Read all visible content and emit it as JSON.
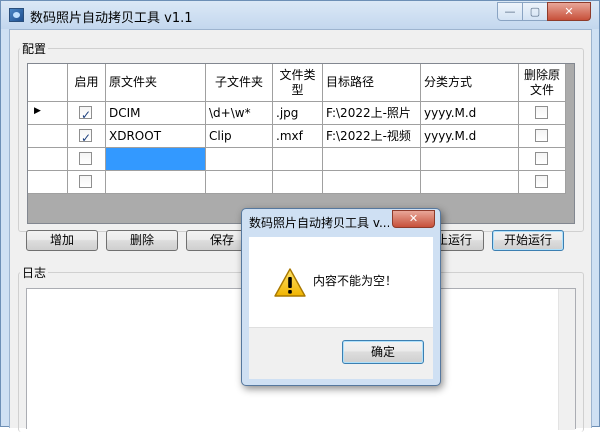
{
  "window": {
    "title": "数码照片自动拷贝工具 v1.1",
    "min_glyph": "—",
    "max_glyph": "▢",
    "close_glyph": "✕"
  },
  "config": {
    "group_label": "配置",
    "columns": [
      "启用",
      "原文件夹",
      "子文件夹",
      "文件类型",
      "目标路径",
      "分类方式",
      "删除原文件"
    ],
    "rows": [
      {
        "enabled": true,
        "source": "DCIM",
        "subfolder": "\\d+\\w*",
        "filetype": ".jpg",
        "target": "F:\\2022上-照片",
        "classify": "yyyy.M.d",
        "delete": false,
        "current": true
      },
      {
        "enabled": true,
        "source": "XDROOT",
        "subfolder": "Clip",
        "filetype": ".mxf",
        "target": "F:\\2022上-视频",
        "classify": "yyyy.M.d",
        "delete": false,
        "current": false
      },
      {
        "enabled": false,
        "source": "",
        "subfolder": "",
        "filetype": "",
        "target": "",
        "classify": "",
        "delete": false,
        "current": false
      },
      {
        "enabled": false,
        "source": "",
        "subfolder": "",
        "filetype": "",
        "target": "",
        "classify": "",
        "delete": false,
        "current": false
      }
    ],
    "current_row_glyph": "▶"
  },
  "buttons": {
    "add": "增加",
    "delete": "删除",
    "save": "保存",
    "stop": "停止运行",
    "start": "开始运行"
  },
  "log": {
    "group_label": "日志"
  },
  "dialog": {
    "title": "数码照片自动拷贝工具 v...",
    "close_glyph": "✕",
    "message": "内容不能为空！",
    "ok": "确定",
    "icon": "warning-icon"
  }
}
